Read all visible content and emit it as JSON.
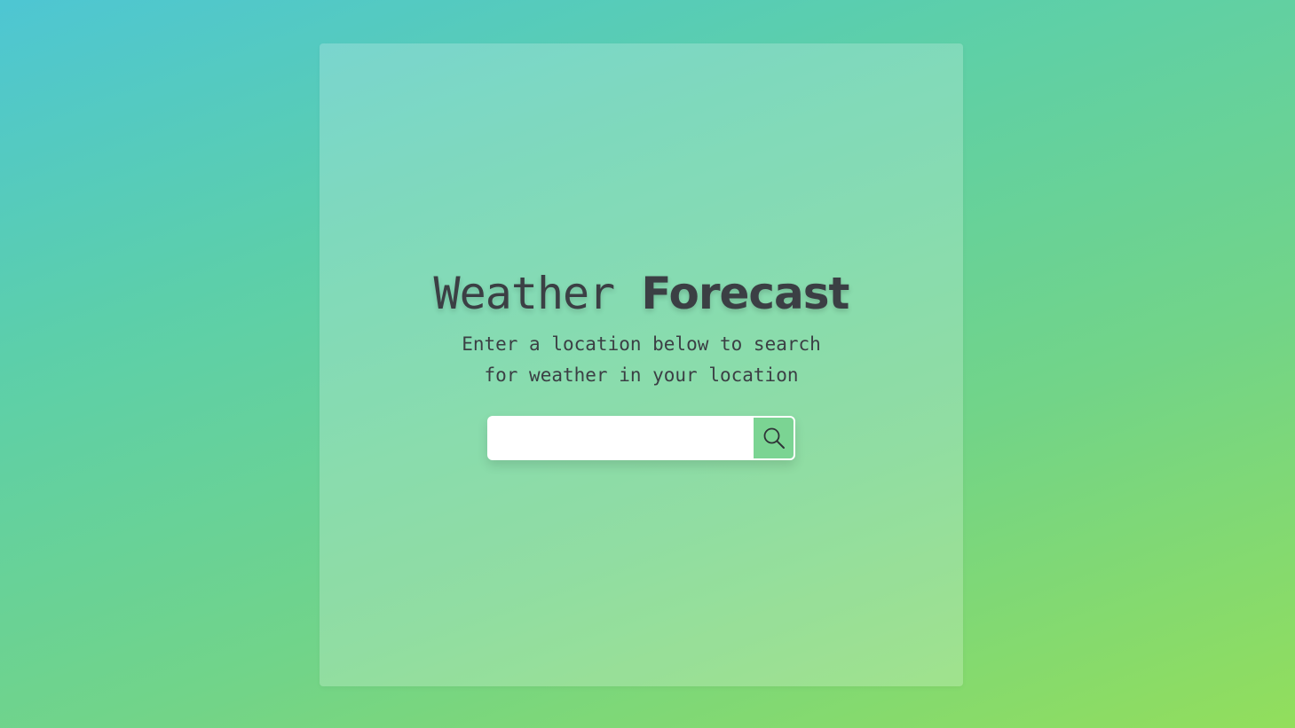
{
  "header": {
    "title_light": "Weather",
    "title_bold": "Forecast",
    "subtitle": "Enter a location below to search for weather in your location"
  },
  "search": {
    "value": "",
    "placeholder": "",
    "button_icon": "search-icon"
  },
  "colors": {
    "background_start": "#4ec6d3",
    "background_end": "#92de5c",
    "text": "#3b3f44",
    "button_background": "#7bd493"
  }
}
